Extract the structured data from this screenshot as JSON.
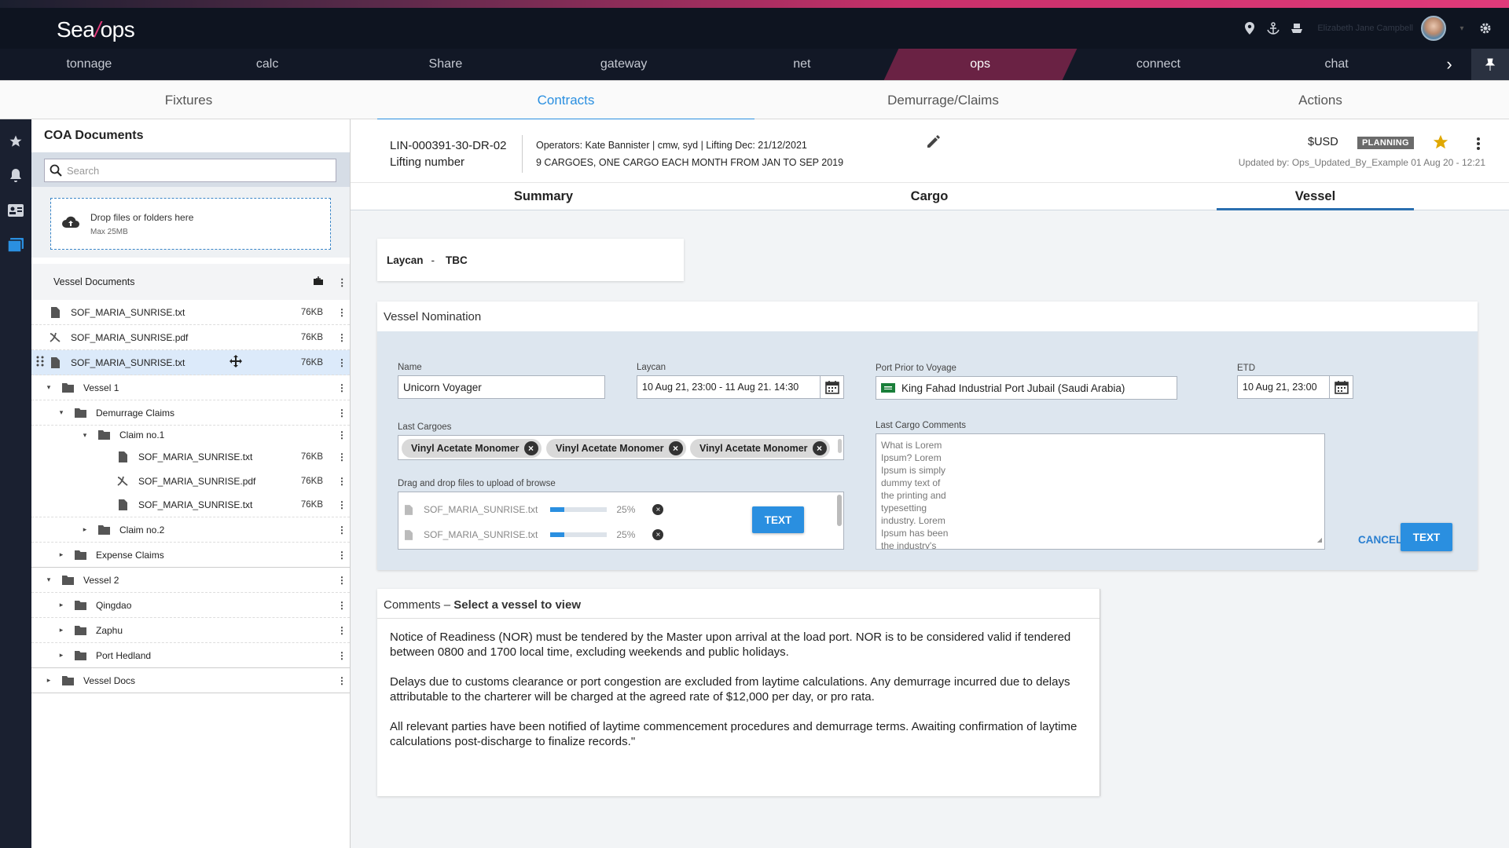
{
  "brand": {
    "logo_left": "Sea",
    "logo_slash": "/",
    "logo_right": "ops"
  },
  "header": {
    "username": "Elizabeth Jane Campbell"
  },
  "main_nav": [
    "tonnage",
    "calc",
    "Share",
    "gateway",
    "net",
    "ops",
    "connect",
    "chat"
  ],
  "main_nav_active": "ops",
  "sub_nav": [
    {
      "label": "Fixtures",
      "active": false
    },
    {
      "label": "Contracts",
      "active": true
    },
    {
      "label": "Demurrage/Claims",
      "active": false
    },
    {
      "label": "Actions",
      "active": false
    }
  ],
  "left_panel": {
    "title": "COA Documents",
    "search_placeholder": "Search",
    "dropzone_main": "Drop files or folders here",
    "dropzone_sub": "Max 25MB",
    "section_title": "Vessel Documents",
    "rows": [
      {
        "label": "SOF_MARIA_SUNRISE.txt",
        "size": "76KB"
      },
      {
        "label": "SOF_MARIA_SUNRISE.pdf",
        "size": "76KB"
      },
      {
        "label": "SOF_MARIA_SUNRISE.txt",
        "size": "76KB"
      },
      {
        "label": "Vessel 1"
      },
      {
        "label": "Demurrage Claims"
      },
      {
        "label": "Claim no.1"
      },
      {
        "label": "SOF_MARIA_SUNRISE.txt",
        "size": "76KB"
      },
      {
        "label": "SOF_MARIA_SUNRISE.pdf",
        "size": "76KB"
      },
      {
        "label": "SOF_MARIA_SUNRISE.txt",
        "size": "76KB"
      },
      {
        "label": "Claim no.2"
      },
      {
        "label": "Expense Claims"
      },
      {
        "label": "Vessel 2"
      },
      {
        "label": "Qingdao"
      },
      {
        "label": "Zaphu"
      },
      {
        "label": "Port Hedland"
      },
      {
        "label": "Vessel Docs"
      }
    ]
  },
  "info": {
    "lifting_id": "LIN-000391-30-DR-02",
    "lifting_label": "Lifting number",
    "operators": "Operators: Kate Bannister | cmw, syd | Lifting Dec: 21/12/2021",
    "cargoes": "9 CARGOES, ONE CARGO EACH MONTH FROM JAN TO SEP 2019",
    "currency": "$USD",
    "status": "PLANNING",
    "updated": "Updated by: Ops_Updated_By_Example 01 Aug 20 - 12:21"
  },
  "tabs": [
    {
      "label": "Summary",
      "active": false
    },
    {
      "label": "Cargo",
      "active": false
    },
    {
      "label": "Vessel",
      "active": true
    }
  ],
  "laycan": {
    "label": "Laycan",
    "sep": "-",
    "value": "TBC"
  },
  "nomination": {
    "title": "Vessel Nomination",
    "name_label": "Name",
    "name_value": "Unicorn Voyager",
    "laycan_label": "Laycan",
    "laycan_value": "10 Aug 21, 23:00 - 11 Aug 21. 14:30",
    "port_label": "Port Prior to Voyage",
    "port_value": "King Fahad Industrial Port Jubail (Saudi Arabia)",
    "etd_label": "ETD",
    "etd_value": "10 Aug 21, 23:00",
    "last_cargoes_label": "Last Cargoes",
    "last_cargoes": [
      "Vinyl Acetate Monomer",
      "Vinyl Acetate Monomer",
      "Vinyl Acetate Monomer"
    ],
    "upload_label": "Drag and drop files to upload of browse",
    "uploads": [
      {
        "file": "SOF_MARIA_SUNRISE.txt",
        "progress": 25,
        "progress_label": "25%"
      },
      {
        "file": "SOF_MARIA_SUNRISE.txt",
        "progress": 25,
        "progress_label": "25%"
      }
    ],
    "upload_button": "TEXT",
    "last_cargo_comments_label": "Last Cargo Comments",
    "last_cargo_comments": "What is Lorem Ipsum? Lorem Ipsum is simply dummy text of the printing and typesetting industry. Lorem Ipsum has been the industry's",
    "cancel_button": "CANCEL",
    "submit_button": "TEXT"
  },
  "comments": {
    "title": "Comments",
    "dash": "–",
    "subtitle": "Select a vessel to view",
    "paragraphs": [
      "Notice of Readiness (NOR) must be tendered by the Master upon arrival at the load port. NOR is to be considered valid if tendered between 0800 and 1700 local time, excluding weekends and public holidays.",
      "Delays due to customs clearance or port congestion are excluded from laytime calculations. Any demurrage incurred due to delays attributable to the charterer will be charged at the agreed rate of $12,000 per day, or pro rata.",
      "All relevant parties have been notified of laytime commencement procedures and demurrage terms. Awaiting confirmation of laytime calculations post-discharge to finalize records.\""
    ]
  }
}
